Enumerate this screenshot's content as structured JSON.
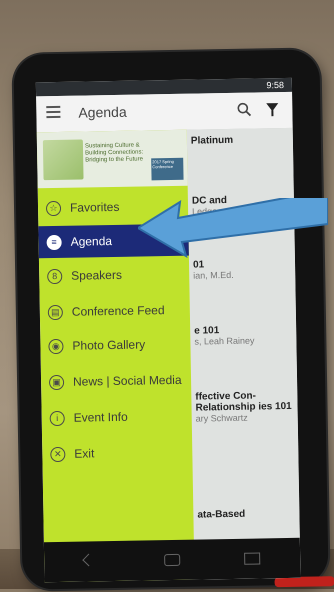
{
  "statusbar": {
    "time": "9:58"
  },
  "appbar": {
    "title": "Agenda"
  },
  "banner": {
    "line1": "2017 Spring Conference",
    "line2": "Sustaining Culture & Building Connections: Bridging to the Future"
  },
  "drawer": {
    "items": [
      {
        "label": "Favorites",
        "icon": "star-icon",
        "glyph": "☆"
      },
      {
        "label": "Agenda",
        "icon": "agenda-icon",
        "glyph": "≡",
        "active": true
      },
      {
        "label": "Speakers",
        "icon": "speakers-icon",
        "glyph": "8"
      },
      {
        "label": "Conference Feed",
        "icon": "feed-icon",
        "glyph": "▤"
      },
      {
        "label": "Photo Gallery",
        "icon": "camera-icon",
        "glyph": "◉"
      },
      {
        "label": "News | Social Media",
        "icon": "news-icon",
        "glyph": "▣"
      },
      {
        "label": "Event Info",
        "icon": "info-icon",
        "glyph": "i"
      },
      {
        "label": "Exit",
        "icon": "exit-icon",
        "glyph": "✕"
      }
    ]
  },
  "content": {
    "rows": [
      {
        "main": "Platinum",
        "sub": ""
      },
      {
        "main": "DC and",
        "sub": "Ledger"
      },
      {
        "main": "01",
        "sub": "ian, M.Ed."
      },
      {
        "main": "e 101",
        "sub": "s, Leah Rainey"
      },
      {
        "main": "ffective Con- Relationship ies 101",
        "sub": "ary Schwartz"
      },
      {
        "main": "ata-Based",
        "sub": ""
      }
    ]
  },
  "colors": {
    "drawer_bg": "#bfe22c",
    "active_bg": "#1c2a78",
    "arrow": "#5aa0d8"
  }
}
